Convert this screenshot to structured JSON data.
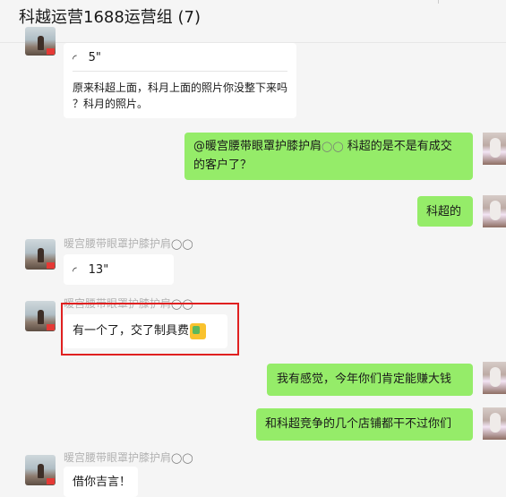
{
  "header": {
    "title": "科越运营1688运营组 (7)"
  },
  "messages": {
    "m1": {
      "voice_duration": "5\"",
      "quote": "原来科超上面，科月上面的照片你没整下来吗",
      "quote2": "？科月的照片。"
    },
    "m2": {
      "line1": "@暖宫腰带眼罩护膝护肩",
      "line1b": " 科超的是不是有成交",
      "line2": "的客户了？"
    },
    "m3": {
      "text": "科超的"
    },
    "m4": {
      "sender": "暖宫腰带眼罩护膝护肩",
      "voice_duration": "13\""
    },
    "m5": {
      "sender": "暖宫腰带眼罩护膝护肩",
      "text": "有一个了，交了制具费"
    },
    "m6": {
      "text": "我有感觉，今年你们肯定能赚大钱"
    },
    "m7": {
      "text": "和科超竞争的几个店铺都干不过你们"
    },
    "m8": {
      "sender": "暖宫腰带眼罩护膝护肩",
      "text": "借你吉言！"
    }
  },
  "colors": {
    "self_bubble": "#95ec69",
    "other_bubble": "#ffffff",
    "highlight_box": "#e02020",
    "background": "#f5f5f5"
  }
}
